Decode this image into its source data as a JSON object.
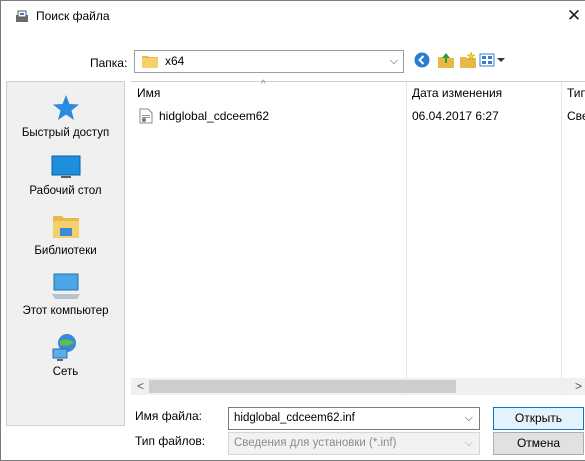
{
  "window": {
    "title": "Поиск файла"
  },
  "folder": {
    "label": "Папка:",
    "current": "x64"
  },
  "toolbar": {
    "icons": [
      "back-icon",
      "up-folder-icon",
      "new-folder-icon",
      "view-menu-icon"
    ]
  },
  "places": [
    {
      "label": "Быстрый доступ",
      "icon": "quick-access-star-icon"
    },
    {
      "label": "Рабочий стол",
      "icon": "desktop-icon"
    },
    {
      "label": "Библиотеки",
      "icon": "libraries-icon"
    },
    {
      "label": "Этот компьютер",
      "icon": "computer-icon"
    },
    {
      "label": "Сеть",
      "icon": "network-icon"
    }
  ],
  "columns": {
    "name": "Имя",
    "date": "Дата изменения",
    "type": "Тип"
  },
  "files": [
    {
      "name": "hidglobal_cdceem62",
      "date": "06.04.2017 6:27",
      "type": "Свед",
      "icon": "setup-info-file-icon"
    }
  ],
  "filename": {
    "label": "Имя файла:",
    "value": "hidglobal_cdceem62.inf"
  },
  "filetype": {
    "label": "Тип файлов:",
    "value": "Сведения для установки (*.inf)"
  },
  "buttons": {
    "open": "Открыть",
    "cancel": "Отмена"
  },
  "colors": {
    "accent": "#0078d7",
    "folder": "#e8b84b",
    "places_bg": "#f0f0f0"
  }
}
